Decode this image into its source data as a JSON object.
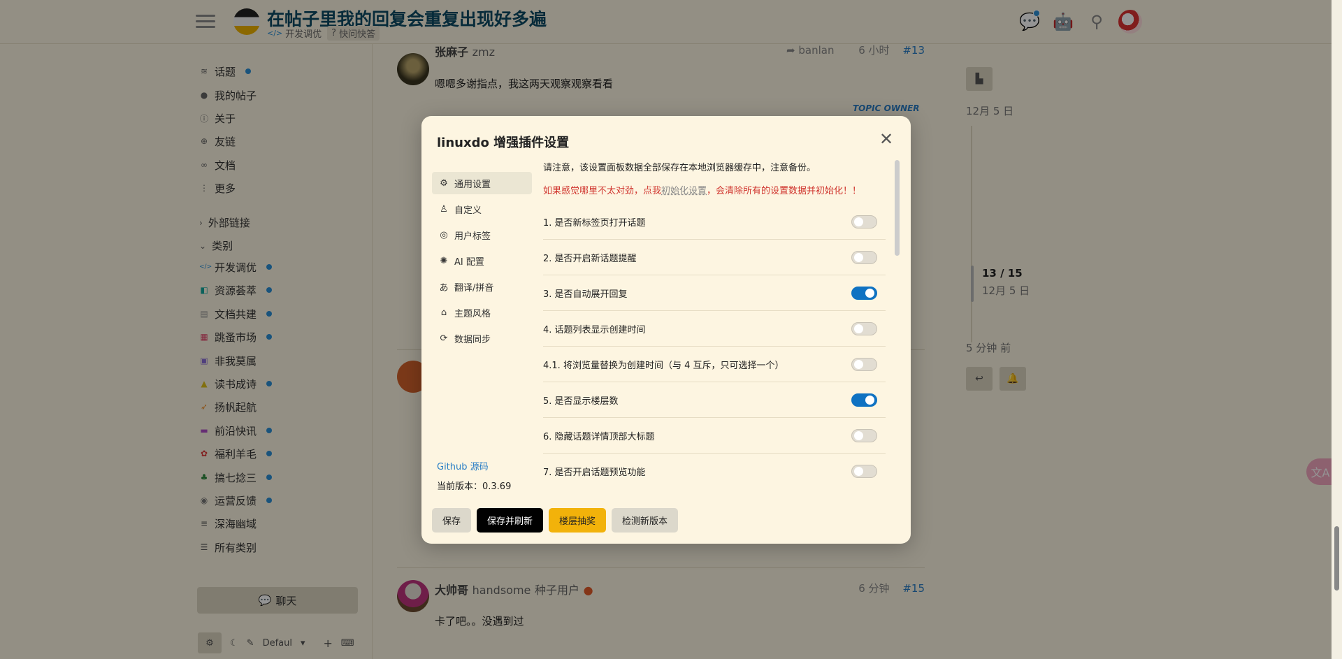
{
  "header": {
    "title": "在帖子里我的回复会重复出现好多遍",
    "category": "开发调优",
    "tag": "快问快答"
  },
  "sidebar": {
    "items": [
      {
        "label": "话题",
        "icon": "layers-icon",
        "dot": true
      },
      {
        "label": "我的帖子",
        "icon": "user-icon",
        "dot": false
      },
      {
        "label": "关于",
        "icon": "info-icon",
        "dot": false
      },
      {
        "label": "友链",
        "icon": "globe-icon",
        "dot": false
      },
      {
        "label": "文档",
        "icon": "link-icon",
        "dot": false
      },
      {
        "label": "更多",
        "icon": "more-icon",
        "dot": false
      }
    ],
    "external_section": "外部链接",
    "category_section": "类别",
    "categories": [
      {
        "label": "开发调优",
        "color": "#2b8fd6"
      },
      {
        "label": "资源荟萃",
        "color": "#12a89d"
      },
      {
        "label": "文档共建",
        "color": "#999999"
      },
      {
        "label": "跳蚤市场",
        "color": "#e4456c"
      },
      {
        "label": "非我莫属",
        "color": "#8a6dd8"
      },
      {
        "label": "读书成诗",
        "color": "#e0c21a"
      },
      {
        "label": "扬帆起航",
        "color": "#f08a24"
      },
      {
        "label": "前沿快讯",
        "color": "#b04ec9"
      },
      {
        "label": "福利羊毛",
        "color": "#e03a3a"
      },
      {
        "label": "搞七捻三",
        "color": "#2e8b3e"
      },
      {
        "label": "运营反馈",
        "color": "#777777"
      },
      {
        "label": "深海幽域",
        "color": "#555555"
      },
      {
        "label": "所有类别",
        "color": "#555555"
      }
    ],
    "chat_label": "聊天",
    "theme_label": "Defaul"
  },
  "posts": [
    {
      "name": "张麻子",
      "handle": "zmz",
      "reply_to": "banlan",
      "time": "6 小时",
      "num": "#13",
      "body": "嗯嗯多谢指点，我这两天观察观察看看",
      "tag": "TOPIC OWNER"
    },
    {
      "name": "大帅哥",
      "handle": "handsome",
      "title": "种子用户",
      "time": "6 分钟",
      "num": "#15",
      "body": "卡了吧。。没遇到过"
    }
  ],
  "timeline": {
    "top_date": "12月 5 日",
    "progress": "13 / 15",
    "progress_date": "12月 5 日",
    "bottom_time": "5 分钟 前"
  },
  "modal": {
    "title": "linuxdo 增强插件设置",
    "nav": [
      {
        "label": "通用设置",
        "icon": "gear-icon",
        "active": true
      },
      {
        "label": "自定义",
        "icon": "user-icon",
        "active": false
      },
      {
        "label": "用户标签",
        "icon": "user-tag-icon",
        "active": false
      },
      {
        "label": "AI 配置",
        "icon": "ai-icon",
        "active": false
      },
      {
        "label": "翻译/拼音",
        "icon": "translate-icon",
        "active": false
      },
      {
        "label": "主题风格",
        "icon": "theme-icon",
        "active": false
      },
      {
        "label": "数据同步",
        "icon": "sync-icon",
        "active": false
      }
    ],
    "github_label": "Github 源码",
    "version_label": "当前版本：0.3.69",
    "notice": "请注意，该设置面板数据全部保存在本地浏览器缓存中，注意备份。",
    "warn_prefix": "如果感觉哪里不太对劲，点我",
    "warn_link": "初始化设置",
    "warn_suffix": "，会清除所有的设置数据并初始化！！",
    "settings": [
      {
        "label": "1. 是否新标签页打开话题",
        "on": false
      },
      {
        "label": "2. 是否开启新话题提醒",
        "on": false
      },
      {
        "label": "3. 是否自动展开回复",
        "on": true
      },
      {
        "label": "4. 话题列表显示创建时间",
        "on": false
      },
      {
        "label": "4.1. 将浏览量替换为创建时间（与 4 互斥，只可选择一个）",
        "on": false
      },
      {
        "label": "5. 是否显示楼层数",
        "on": true
      },
      {
        "label": "6. 隐藏话题详情顶部大标题",
        "on": false
      },
      {
        "label": "7. 是否开启话题预览功能",
        "on": false
      }
    ],
    "buttons": {
      "save": "保存",
      "save_refresh": "保存并刷新",
      "lottery": "楼层抽奖",
      "check_version": "检测新版本"
    }
  },
  "colors": {
    "accent": "#0f72c2",
    "page_bg": "#fdf6e3",
    "warn": "#d0352e",
    "gold": "#f2b20a"
  }
}
